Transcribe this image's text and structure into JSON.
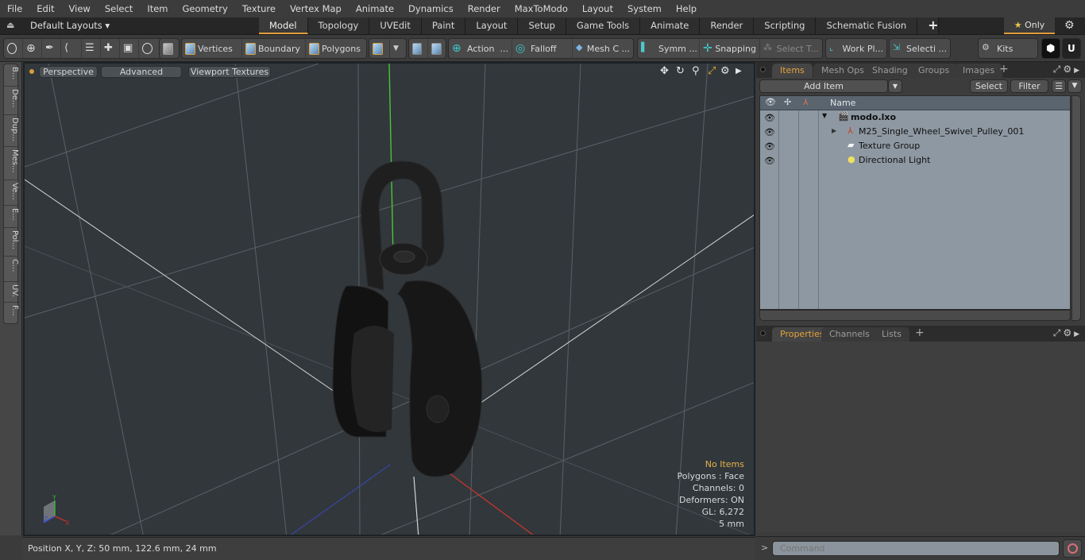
{
  "menu": [
    "File",
    "Edit",
    "View",
    "Select",
    "Item",
    "Geometry",
    "Texture",
    "Vertex Map",
    "Animate",
    "Dynamics",
    "Render",
    "MaxToModo",
    "Layout",
    "System",
    "Help"
  ],
  "layoutbar": {
    "layout_select": "Default Layouts ▾",
    "tabs": [
      "Model",
      "Topology",
      "UVEdit",
      "Paint",
      "Layout",
      "Setup",
      "Game Tools",
      "Animate",
      "Render",
      "Scripting",
      "Schematic Fusion"
    ],
    "active_tab": "Model",
    "add_tab": "+",
    "only_label": "Only",
    "accent_color": "#e19c38"
  },
  "toolbar": {
    "vertices": "Vertices",
    "boundary": "Boundary",
    "polygons": "Polygons",
    "action": "Action",
    "action_more": "...",
    "falloff": "Falloff",
    "mesh_constraint": "Mesh C ...",
    "symmetry": "Symm ...",
    "snapping": "Snapping",
    "select_through": "Select T...",
    "work_plane": "Work Pl...",
    "selection_sets": "Selecti ...",
    "kits": "Kits"
  },
  "lefttabs": [
    "B...",
    "De...",
    "Dup...",
    "Mes...",
    "Ve...",
    "E...",
    "Pol...",
    "C...",
    "UV.",
    "F..."
  ],
  "viewport": {
    "view_mode": "Perspective",
    "shading": "Advanced",
    "textures": "Viewport Textures",
    "hud": {
      "selection": "No Items",
      "polygons": "Polygons : Face",
      "channels": "Channels: 0",
      "deformers": "Deformers: ON",
      "gl": "GL: 6,272",
      "grid": "5 mm"
    },
    "axis_labels": {
      "x": "X",
      "y": "Y",
      "z": "Z"
    }
  },
  "statusbar": {
    "position": "Position X, Y, Z:   50 mm, 122.6 mm, 24 mm"
  },
  "itemspanel": {
    "tabs": [
      "Items",
      "Mesh Ops",
      "Shading",
      "Groups",
      "Images"
    ],
    "active_tab": "Items",
    "add_item": "Add Item",
    "select": "Select",
    "filter": "Filter",
    "column_name": "Name",
    "rows": [
      {
        "name": "modo.lxo",
        "icon": "scene-icon",
        "expanded": true
      },
      {
        "name": "M25_Single_Wheel_Swivel_Pulley_001",
        "icon": "mesh-locator-icon",
        "expanded": false
      },
      {
        "name": "Texture Group",
        "icon": "texture-group-icon"
      },
      {
        "name": "Directional Light",
        "icon": "light-icon"
      }
    ]
  },
  "propspanel": {
    "tabs": [
      "Properties",
      "Channels",
      "Lists"
    ],
    "active_tab": "Properties"
  },
  "command": {
    "prompt": ">",
    "placeholder": "Command"
  }
}
